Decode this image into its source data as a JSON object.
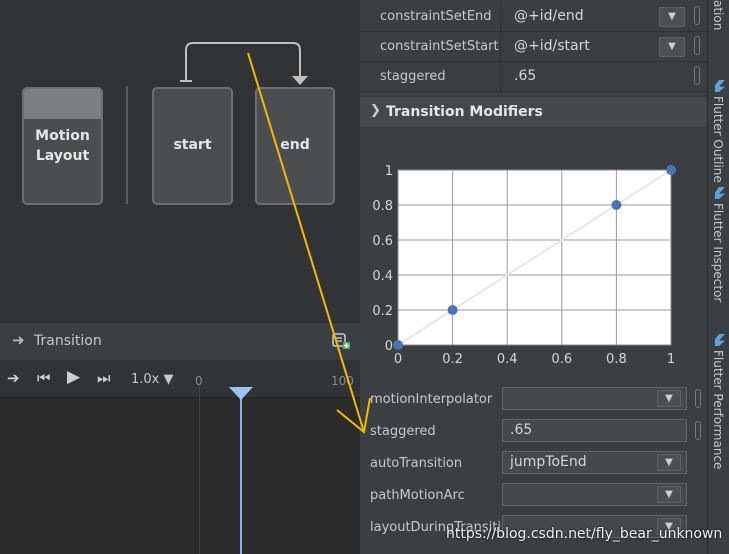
{
  "canvas": {
    "nodes": [
      {
        "label": "Motion\nLayout"
      },
      {
        "label": "start"
      },
      {
        "label": "end"
      }
    ]
  },
  "transition_panel": {
    "title": "Transition",
    "speed": "1.0x",
    "tick_start": "0",
    "tick_end": "100"
  },
  "attributes": {
    "rows": [
      {
        "key": "constraintSetEnd",
        "value": "@+id/end"
      },
      {
        "key": "constraintSetStart",
        "value": "@+id/start"
      },
      {
        "key": "staggered",
        "value": ".65"
      }
    ],
    "section_title": "Transition Modifiers",
    "form_rows": [
      {
        "key": "motionInterpolator",
        "value": ""
      },
      {
        "key": "staggered",
        "value": ".65"
      },
      {
        "key": "autoTransition",
        "value": "jumpToEnd"
      },
      {
        "key": "pathMotionArc",
        "value": ""
      },
      {
        "key": "layoutDuringTransiti…",
        "value": ""
      }
    ]
  },
  "chart_data": {
    "type": "line",
    "x": [
      0,
      0.2,
      0.8,
      1.0
    ],
    "y": [
      0,
      0.2,
      0.8,
      1.0
    ],
    "xlim": [
      0,
      1
    ],
    "ylim": [
      0,
      1
    ],
    "x_ticks": [
      "0",
      "0.2",
      "0.4",
      "0.6",
      "0.8",
      "1"
    ],
    "y_ticks": [
      "0",
      "0.2",
      "0.4",
      "0.6",
      "0.8",
      "1"
    ],
    "grid": true,
    "line_color": "#e6e6e6",
    "point_color": "#4a74b4"
  },
  "tool_strip": {
    "tabs": [
      "ation",
      "Flutter Outline",
      "Flutter Inspector",
      "Flutter Performance"
    ]
  },
  "watermark": "https://blog.csdn.net/fly_bear_unknown",
  "colors": {
    "annotation_arrow": "#f5b800",
    "playhead": "#9cc4f0"
  }
}
